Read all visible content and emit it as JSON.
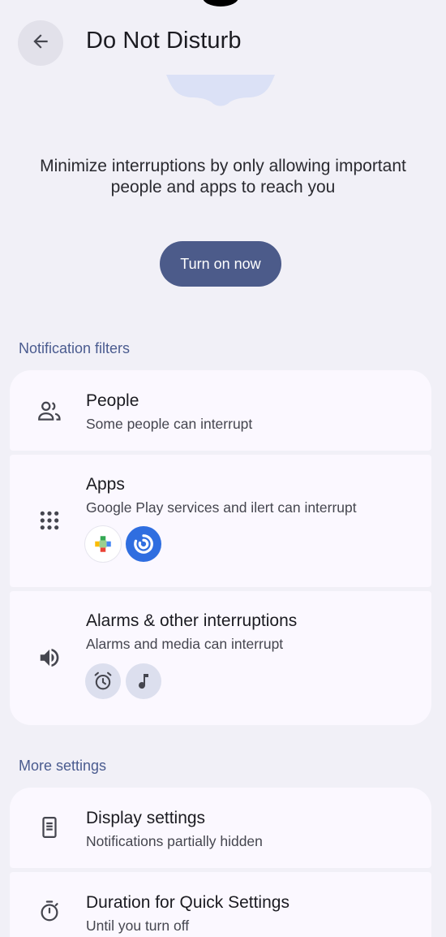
{
  "header": {
    "title": "Do Not Disturb",
    "back_icon": "arrow-back-icon"
  },
  "intro": {
    "description": "Minimize interruptions by only allowing important people and apps to reach you",
    "turn_on_label": "Turn on now"
  },
  "notification_filters": {
    "label": "Notification filters",
    "items": [
      {
        "title": "People",
        "subtitle": "Some people can interrupt",
        "icon": "people-icon"
      },
      {
        "title": "Apps",
        "subtitle": "Google Play services and ilert can interrupt",
        "icon": "apps-grid-icon",
        "app_icons": [
          "google-play-services-icon",
          "ilert-icon"
        ]
      },
      {
        "title": "Alarms & other interruptions",
        "subtitle": "Alarms and media can interrupt",
        "icon": "volume-icon",
        "chips": [
          "alarm-icon",
          "music-note-icon"
        ]
      }
    ]
  },
  "more_settings": {
    "label": "More settings",
    "items": [
      {
        "title": "Display settings",
        "subtitle": "Notifications partially hidden",
        "icon": "phone-display-icon"
      },
      {
        "title": "Duration for Quick Settings",
        "subtitle": "Until you turn off",
        "icon": "timer-icon"
      }
    ]
  },
  "colors": {
    "background": "#f1f0f7",
    "card": "#fbf8ff",
    "primary_button": "#4c5b8a",
    "section_label": "#4a5b8f",
    "chip": "#dcdfee"
  }
}
